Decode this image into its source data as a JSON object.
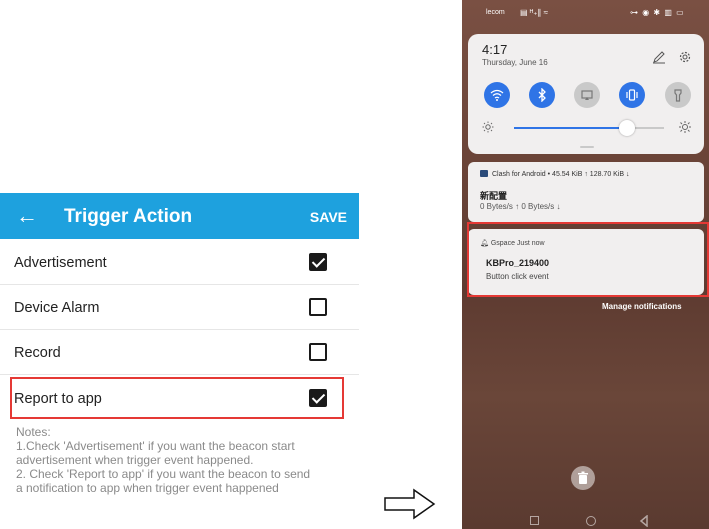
{
  "trigger_screen": {
    "title": "Trigger Action",
    "save_label": "SAVE",
    "back_icon": "←",
    "items": [
      {
        "label": "Advertisement",
        "checked": true
      },
      {
        "label": "Device Alarm",
        "checked": false
      },
      {
        "label": "Record",
        "checked": false
      },
      {
        "label": "Report to app",
        "checked": true
      }
    ],
    "notes": {
      "heading": "Notes:",
      "lines": [
        "1.Check 'Advertisement' if you want the beacon start",
        "advertisement when trigger event happened.",
        "2. Check 'Report to app' if you want the beacon to send",
        "a notification to app when trigger event happened"
      ]
    },
    "accent_color": "#1ea1de",
    "highlight_color": "#e53935"
  },
  "phone": {
    "status_bar": {
      "carrier": "lecom",
      "signal": "▤ ᴴ₊∥ ≈",
      "right_icons": "⊶ ◉ ✱ ▥ ▭"
    },
    "quick_settings": {
      "time": "4:17",
      "date": "Thursday, June 16",
      "tiles": [
        {
          "icon": "wifi-icon",
          "on": true
        },
        {
          "icon": "bluetooth-icon",
          "on": true
        },
        {
          "icon": "screencast-icon",
          "on": false
        },
        {
          "icon": "vibrate-icon",
          "on": true
        },
        {
          "icon": "flashlight-icon",
          "on": false
        }
      ],
      "brightness": 0.75
    },
    "notifications": [
      {
        "app": "Clash for Android",
        "meta": "•  45.54 KiB ↑  128.70 KiB ↓",
        "title": "新配置",
        "body": "0 Bytes/s ↑ 0 Bytes/s ↓"
      },
      {
        "app": "Gspace",
        "meta": "Just now",
        "title": "KBPro_219400",
        "body": "Button click event"
      }
    ],
    "manage_label": "Manage notifications"
  }
}
